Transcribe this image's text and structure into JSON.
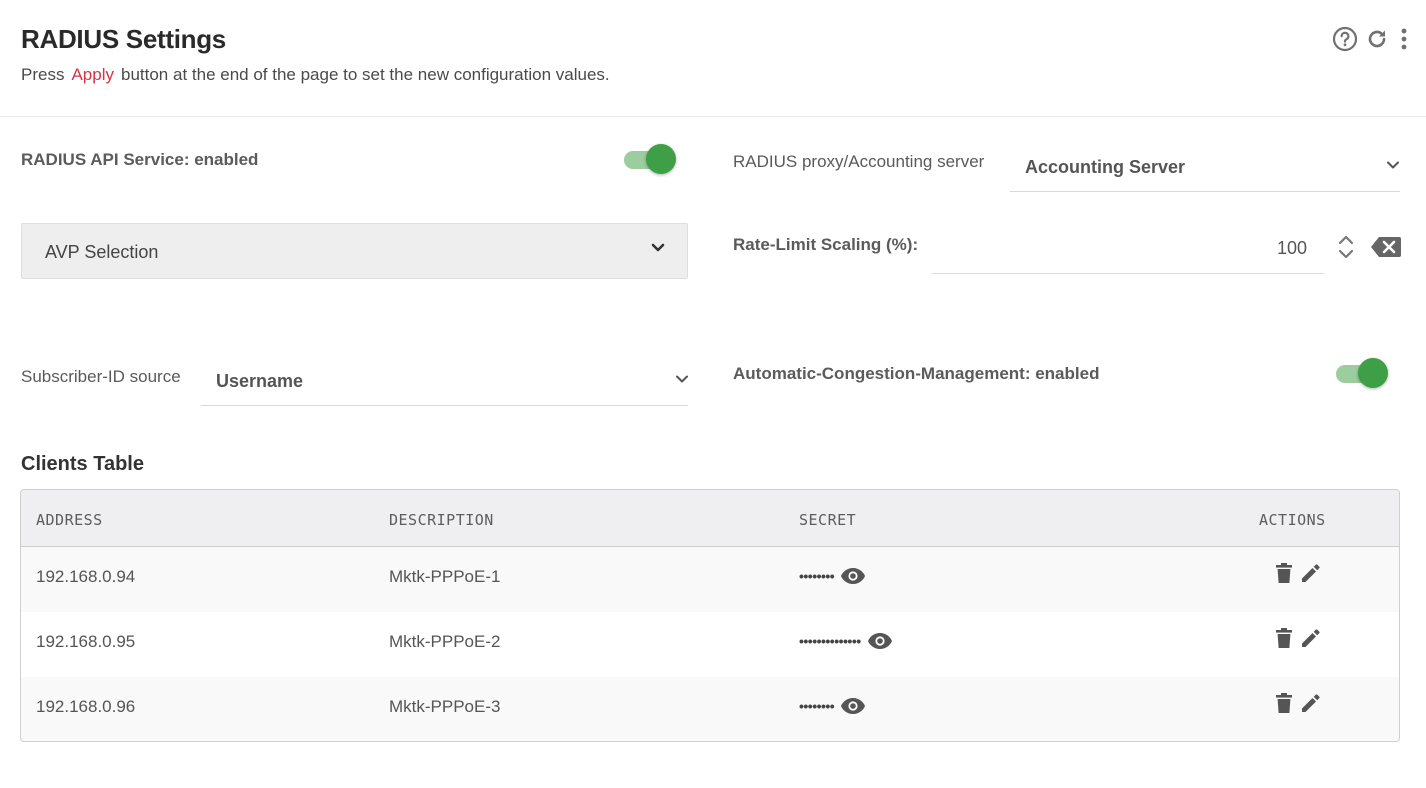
{
  "header": {
    "title": "RADIUS Settings",
    "subtitle_pre": "Press",
    "subtitle_apply": "Apply",
    "subtitle_post": "button at the end of the page to set the new configuration values.",
    "icons": [
      "help-circle-icon",
      "refresh-icon",
      "more-vertical-icon"
    ]
  },
  "radius_api": {
    "label": "RADIUS API Service: enabled",
    "enabled": true
  },
  "proxy": {
    "label": "RADIUS proxy/Accounting server",
    "value": "Accounting Server"
  },
  "avp": {
    "value": "AVP Selection"
  },
  "rate_limit": {
    "label": "Rate-Limit Scaling (%):",
    "value": "100"
  },
  "subscriber": {
    "label": "Subscriber-ID source",
    "value": "Username"
  },
  "congestion": {
    "label": "Automatic-Congestion-Management: enabled",
    "enabled": true
  },
  "clients": {
    "title": "Clients Table",
    "columns": [
      "ADDRESS",
      "DESCRIPTION",
      "SECRET",
      "ACTIONS"
    ],
    "rows": [
      {
        "address": "192.168.0.94",
        "description": "Mktk-PPPoE-1",
        "secret": "••••••••"
      },
      {
        "address": "192.168.0.95",
        "description": "Mktk-PPPoE-2",
        "secret": "••••••••••••••"
      },
      {
        "address": "192.168.0.96",
        "description": "Mktk-PPPoE-3",
        "secret": "••••••••"
      }
    ]
  },
  "colors": {
    "accent_green": "#3e9f46",
    "apply_red": "#d6334b"
  }
}
